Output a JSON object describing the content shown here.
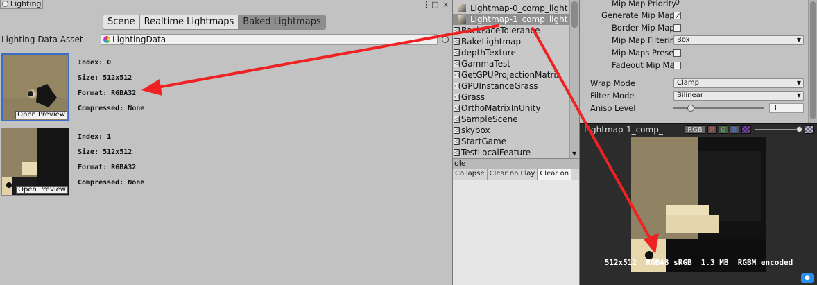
{
  "lighting_window": {
    "tab_title": "Lighting",
    "window_controls": [
      "⋮",
      "□",
      "×"
    ],
    "mode_tabs": [
      {
        "label": "Scene",
        "active": false
      },
      {
        "label": "Realtime Lightmaps",
        "active": false
      },
      {
        "label": "Baked Lightmaps",
        "active": true
      }
    ],
    "asset_label": "Lighting Data Asset",
    "asset_value": "LightingData",
    "lightmaps": [
      {
        "index": "Index: 0",
        "size": "Size: 512x512",
        "format": "Format: RGBA32",
        "compressed": "Compressed: None",
        "open_preview": "Open Preview",
        "selected": true
      },
      {
        "index": "Index: 1",
        "size": "Size: 512x512",
        "format": "Format: RGBA32",
        "compressed": "Compressed: None",
        "open_preview": "Open Preview",
        "selected": false
      }
    ]
  },
  "project_panel": {
    "items": [
      {
        "label": "Lightmap-0_comp_light",
        "type": "lightmap",
        "selected": false
      },
      {
        "label": "Lightmap-1_comp_light",
        "type": "lightmap",
        "selected": true
      },
      {
        "label": "BackFaceTolerance",
        "type": "scene"
      },
      {
        "label": "BakeLightmap",
        "type": "scene"
      },
      {
        "label": "depthTexture",
        "type": "scene"
      },
      {
        "label": "GammaTest",
        "type": "scene"
      },
      {
        "label": "GetGPUProjectionMatrix",
        "type": "scene"
      },
      {
        "label": "GPUInstanceGrass",
        "type": "scene"
      },
      {
        "label": "Grass",
        "type": "scene"
      },
      {
        "label": "OrthoMatrixInUnity",
        "type": "scene"
      },
      {
        "label": "SampleScene",
        "type": "scene"
      },
      {
        "label": "skybox",
        "type": "scene"
      },
      {
        "label": "StartGame",
        "type": "scene"
      },
      {
        "label": "TestLocalFeature",
        "type": "scene"
      }
    ],
    "console_tab": "ole",
    "console_buttons": [
      {
        "label": "Collapse",
        "on": false
      },
      {
        "label": "Clear on Play",
        "on": false
      },
      {
        "label": "Clear on",
        "on": true
      }
    ]
  },
  "inspector": {
    "mip_map_priority_label": "Mip Map Priority",
    "mip_map_priority_value": "0",
    "generate_mip_maps_label": "Generate Mip Maps",
    "generate_mip_maps": true,
    "border_mip_map_label": "Border Mip Map",
    "border_mip_map": false,
    "mip_map_filtering_label": "Mip Map Filtering",
    "mip_map_filtering_value": "Box",
    "mip_maps_preserve_label": "Mip Maps Preserve",
    "mip_maps_preserve": false,
    "fadeout_mip_maps_label": "Fadeout Mip Maps",
    "fadeout_mip_maps": false,
    "wrap_mode_label": "Wrap Mode",
    "wrap_mode_value": "Clamp",
    "filter_mode_label": "Filter Mode",
    "filter_mode_value": "Bilinear",
    "aniso_level_label": "Aniso Level",
    "aniso_level_value": "3",
    "aniso_fraction": 0.19,
    "preview": {
      "title": "Lightmap-1_comp_",
      "channels": [
        {
          "label": "RGB",
          "color": "#dddddd"
        },
        {
          "label": "R",
          "color": "#ff4040"
        },
        {
          "label": "G",
          "color": "#40d040"
        },
        {
          "label": "B",
          "color": "#4070ff"
        }
      ],
      "info": "512x512  RGBA8 sRGB  1.3 MB  RGBM encoded"
    }
  },
  "colors": {
    "arrow": "#ee2222",
    "selection": "#3d6cc9"
  }
}
